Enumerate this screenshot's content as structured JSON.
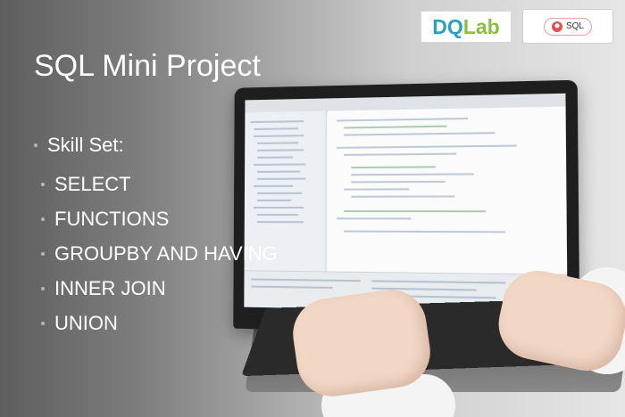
{
  "slide": {
    "title": "SQL Mini Project",
    "skill_heading": "Skill Set:",
    "skills": [
      "SELECT",
      "FUNCTIONS",
      "GROUPBY AND HAVING",
      "INNER JOIN",
      "UNION"
    ]
  },
  "logos": {
    "dqlab": {
      "part1": "DQ",
      "part2": "Lab"
    },
    "sql_badge": "SQL"
  },
  "colors": {
    "dqlab_blue": "#2aa0c4",
    "dqlab_green": "#8cbf3f",
    "sql_badge_red": "#e05050",
    "text": "#ffffff"
  }
}
